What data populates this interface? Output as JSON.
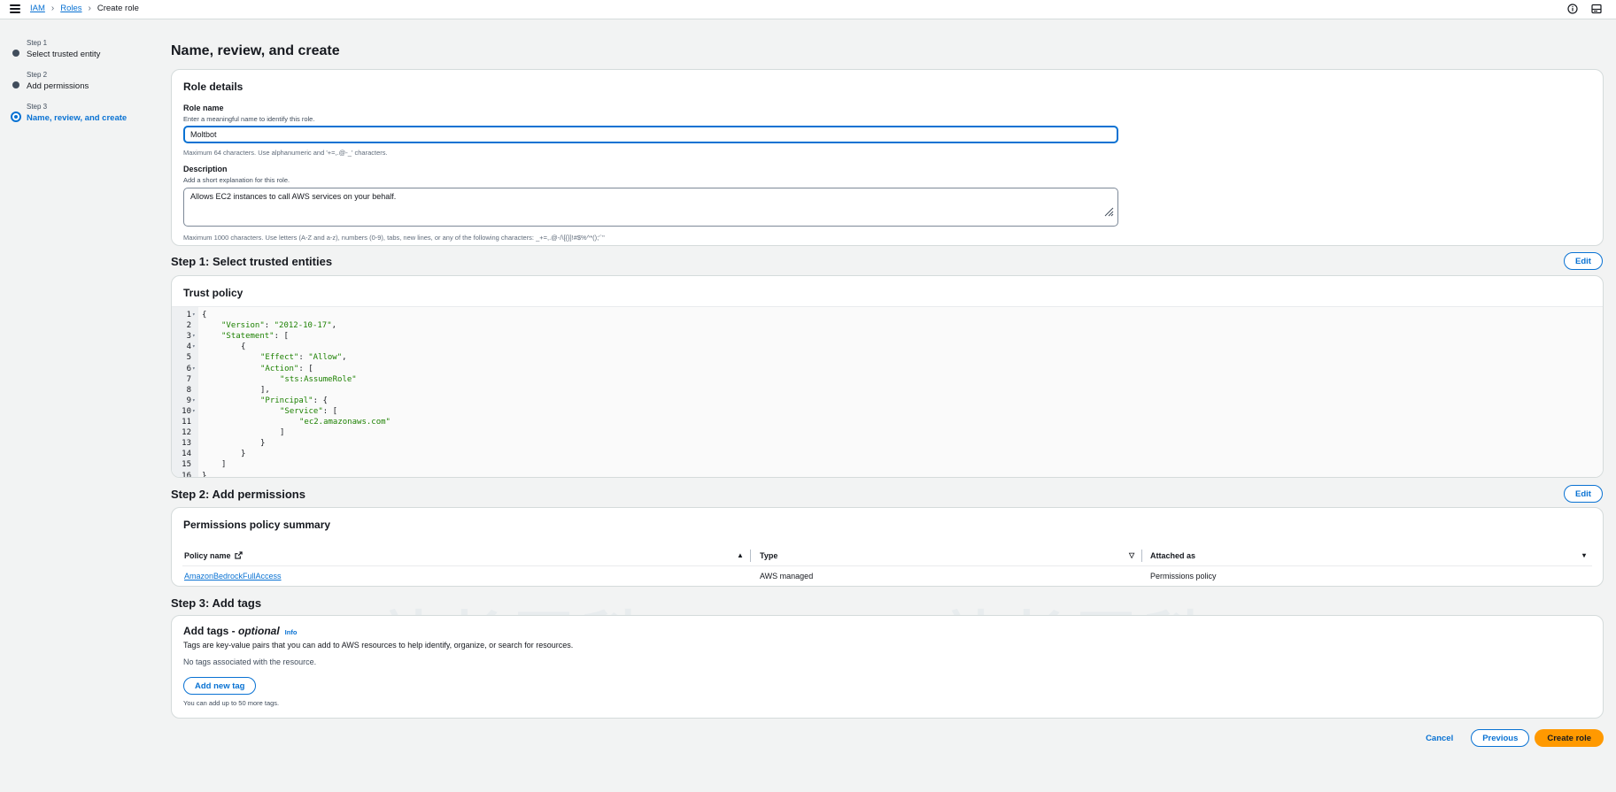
{
  "breadcrumb": {
    "iam": "IAM",
    "roles": "Roles",
    "current": "Create role"
  },
  "steps": [
    {
      "num": "Step 1",
      "label": "Select trusted entity"
    },
    {
      "num": "Step 2",
      "label": "Add permissions"
    },
    {
      "num": "Step 3",
      "label": "Name, review, and create"
    }
  ],
  "page_title": "Name, review, and create",
  "role_details": {
    "title": "Role details",
    "role_name_label": "Role name",
    "role_name_desc": "Enter a meaningful name to identify this role.",
    "role_name_value": "Moltbot",
    "role_name_hint": "Maximum 64 characters. Use alphanumeric and '+=,.@-_' characters.",
    "description_label": "Description",
    "description_desc": "Add a short explanation for this role.",
    "description_value": "Allows EC2 instances to call AWS services on your behalf.",
    "description_hint": "Maximum 1000 characters. Use letters (A-Z and a-z), numbers (0-9), tabs, new lines, or any of the following characters: _+=,.@-/\\[{}]!#$%^*();'`\""
  },
  "step1": {
    "title": "Step 1: Select trusted entities",
    "edit": "Edit",
    "panel_title": "Trust policy",
    "code_lines": [
      {
        "n": "1",
        "fold": true,
        "indent": 0,
        "parts": [
          [
            "p",
            "{"
          ]
        ]
      },
      {
        "n": "2",
        "fold": false,
        "indent": 1,
        "parts": [
          [
            "s",
            "\"Version\""
          ],
          [
            "p",
            ": "
          ],
          [
            "s",
            "\"2012-10-17\""
          ],
          [
            "p",
            ","
          ]
        ]
      },
      {
        "n": "3",
        "fold": true,
        "indent": 1,
        "parts": [
          [
            "s",
            "\"Statement\""
          ],
          [
            "p",
            ": ["
          ]
        ]
      },
      {
        "n": "4",
        "fold": true,
        "indent": 2,
        "parts": [
          [
            "p",
            "{"
          ]
        ]
      },
      {
        "n": "5",
        "fold": false,
        "indent": 3,
        "parts": [
          [
            "s",
            "\"Effect\""
          ],
          [
            "p",
            ": "
          ],
          [
            "s",
            "\"Allow\""
          ],
          [
            "p",
            ","
          ]
        ]
      },
      {
        "n": "6",
        "fold": true,
        "indent": 3,
        "parts": [
          [
            "s",
            "\"Action\""
          ],
          [
            "p",
            ": ["
          ]
        ]
      },
      {
        "n": "7",
        "fold": false,
        "indent": 4,
        "parts": [
          [
            "s",
            "\"sts:AssumeRole\""
          ]
        ]
      },
      {
        "n": "8",
        "fold": false,
        "indent": 3,
        "parts": [
          [
            "p",
            "],"
          ]
        ]
      },
      {
        "n": "9",
        "fold": true,
        "indent": 3,
        "parts": [
          [
            "s",
            "\"Principal\""
          ],
          [
            "p",
            ": {"
          ]
        ]
      },
      {
        "n": "10",
        "fold": true,
        "indent": 4,
        "parts": [
          [
            "s",
            "\"Service\""
          ],
          [
            "p",
            ": ["
          ]
        ]
      },
      {
        "n": "11",
        "fold": false,
        "indent": 5,
        "parts": [
          [
            "s",
            "\"ec2.amazonaws.com\""
          ]
        ]
      },
      {
        "n": "12",
        "fold": false,
        "indent": 4,
        "parts": [
          [
            "p",
            "]"
          ]
        ]
      },
      {
        "n": "13",
        "fold": false,
        "indent": 3,
        "parts": [
          [
            "p",
            "}"
          ]
        ]
      },
      {
        "n": "14",
        "fold": false,
        "indent": 2,
        "parts": [
          [
            "p",
            "}"
          ]
        ]
      },
      {
        "n": "15",
        "fold": false,
        "indent": 1,
        "parts": [
          [
            "p",
            "]"
          ]
        ]
      },
      {
        "n": "16",
        "fold": false,
        "indent": 0,
        "parts": [
          [
            "p",
            "}"
          ]
        ]
      }
    ]
  },
  "step2": {
    "title": "Step 2: Add permissions",
    "edit": "Edit",
    "panel_title": "Permissions policy summary",
    "columns": [
      "Policy name",
      "Type",
      "Attached as"
    ],
    "rows": [
      {
        "policy": "AmazonBedrockFullAccess",
        "type": "AWS managed",
        "attached": "Permissions policy"
      }
    ]
  },
  "step3": {
    "title": "Step 3: Add tags",
    "panel_title": "Add tags - ",
    "panel_title_optional": "optional",
    "info": "Info",
    "desc": "Tags are key-value pairs that you can add to AWS resources to help identify, organize, or search for resources.",
    "empty": "No tags associated with the resource.",
    "add_button": "Add new tag",
    "limit": "You can add up to 50 more tags."
  },
  "footer": {
    "cancel": "Cancel",
    "previous": "Previous",
    "create": "Create role"
  },
  "colors": {
    "accent": "#0972d3",
    "primary_button": "#ff9900",
    "string": "#1d8102"
  },
  "icons": [
    "menu-icon",
    "chevron-right-icon",
    "info-icon",
    "split-panel-icon",
    "external-link-icon",
    "sort-ascending-icon",
    "sort-descending-icon"
  ]
}
